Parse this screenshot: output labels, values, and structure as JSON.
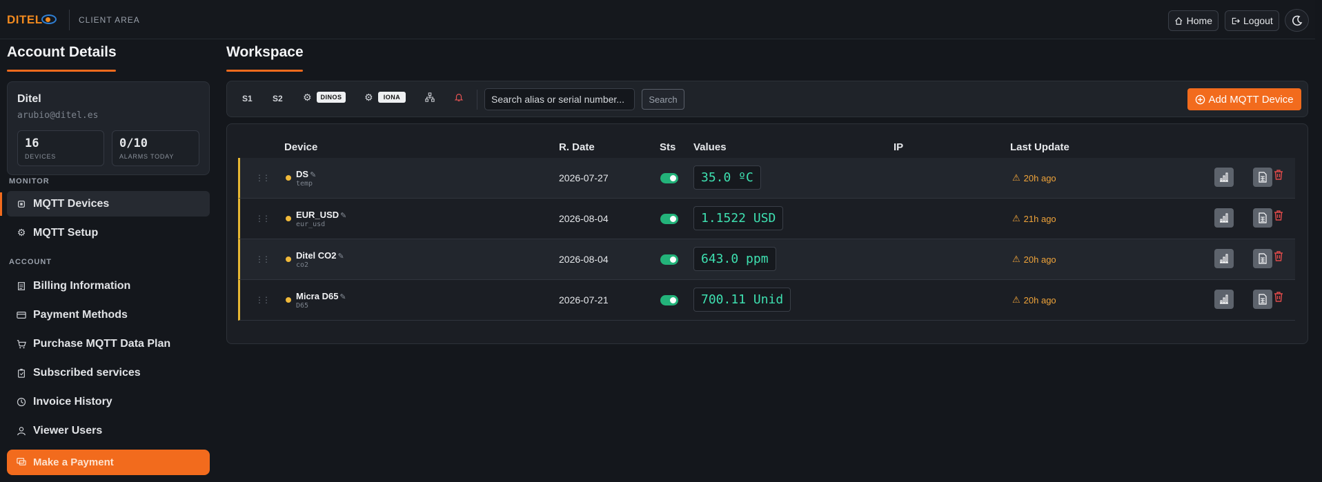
{
  "header": {
    "logo": "DITEL",
    "client_area": "CLIENT AREA",
    "home_label": "Home",
    "logout_label": "Logout"
  },
  "sidebar": {
    "title": "Account Details",
    "account": {
      "name": "Ditel",
      "email": "arubio@ditel.es",
      "devices_count": "16",
      "devices_label": "DEVICES",
      "alarms_count": "0/10",
      "alarms_label": "ALARMS TODAY"
    },
    "monitor_label": "MONITOR",
    "monitor_items": [
      {
        "label": "MQTT Devices",
        "icon": "chip-icon"
      },
      {
        "label": "MQTT Setup",
        "icon": "gear-icon"
      }
    ],
    "account_label": "ACCOUNT",
    "account_items": [
      {
        "label": "Billing Information",
        "icon": "document-icon"
      },
      {
        "label": "Payment Methods",
        "icon": "credit-card-icon"
      },
      {
        "label": "Purchase MQTT Data Plan",
        "icon": "cart-icon"
      },
      {
        "label": "Subscribed services",
        "icon": "clipboard-icon"
      },
      {
        "label": "Invoice History",
        "icon": "clock-icon"
      },
      {
        "label": "Viewer Users",
        "icon": "user-icon"
      }
    ],
    "payment_button": "Make a Payment"
  },
  "workspace": {
    "title": "Workspace",
    "toolbar": {
      "s1": "S1",
      "s2": "S2",
      "chip1": "DINOS",
      "chip2": "IONA",
      "search_placeholder": "Search alias or serial number...",
      "search_button": "Search",
      "add_button": "Add MQTT Device"
    },
    "table": {
      "headers": {
        "device": "Device",
        "rdate": "R. Date",
        "sts": "Sts",
        "values": "Values",
        "ip": "IP",
        "last_update": "Last Update"
      },
      "rows": [
        {
          "name": "DS",
          "sub": "temp",
          "rdate": "2026-07-27",
          "value": "35.0 ºC",
          "last_update": "20h ago"
        },
        {
          "name": "EUR_USD",
          "sub": "eur_usd",
          "rdate": "2026-08-04",
          "value": "1.1522 USD",
          "last_update": "21h ago"
        },
        {
          "name": "Ditel CO2",
          "sub": "co2",
          "rdate": "2026-08-04",
          "value": "643.0 ppm",
          "last_update": "20h ago"
        },
        {
          "name": "Micra D65",
          "sub": "D65",
          "rdate": "2026-07-21",
          "value": "700.11 Unid",
          "last_update": "20h ago"
        }
      ]
    }
  },
  "colors": {
    "accent": "#f26b1d",
    "value_text": "#3ee0b0",
    "status_on": "#23b37a",
    "warning": "#f0a43a",
    "delete": "#e04a4a"
  }
}
